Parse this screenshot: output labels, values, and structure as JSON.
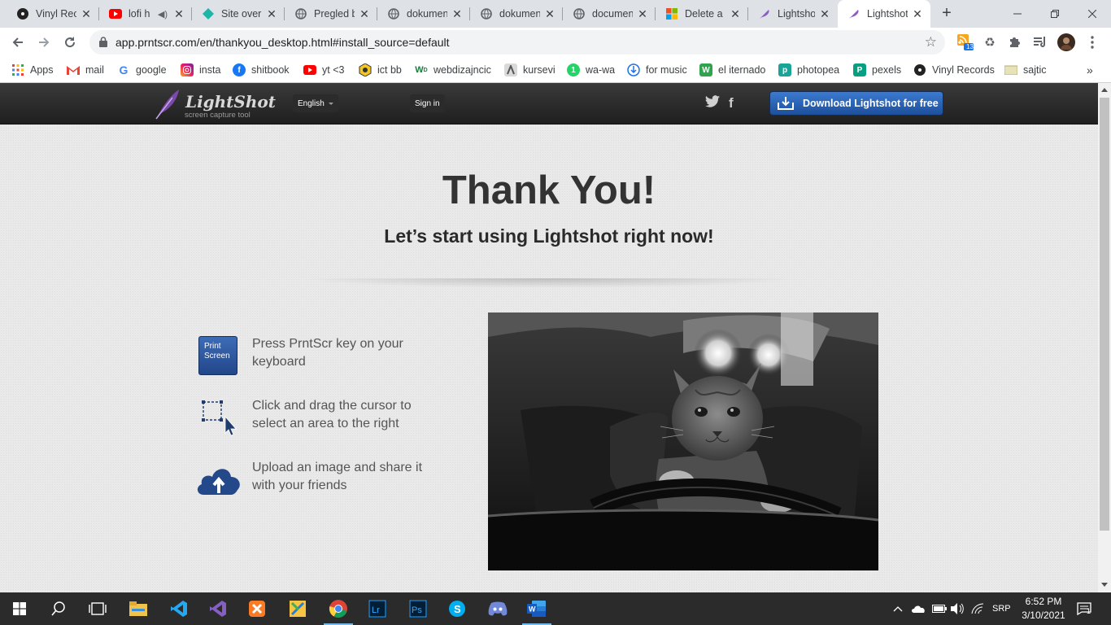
{
  "browser": {
    "tabs": [
      {
        "title": "Vinyl Rec",
        "icon": "vinyl-icon"
      },
      {
        "title": "lofi h",
        "icon": "youtube-icon",
        "audio": true
      },
      {
        "title": "Site over",
        "icon": "diamond-icon"
      },
      {
        "title": "Pregled b",
        "icon": "globe-icon"
      },
      {
        "title": "dokumen",
        "icon": "globe-icon"
      },
      {
        "title": "dokumen",
        "icon": "globe-icon"
      },
      {
        "title": "documen",
        "icon": "globe-icon"
      },
      {
        "title": "Delete a",
        "icon": "microsoft-icon"
      },
      {
        "title": "Lightshot",
        "icon": "feather-icon"
      },
      {
        "title": "Lightshot",
        "icon": "feather-icon",
        "active": true
      }
    ],
    "address": "app.prntscr.com/en/thankyou_desktop.html#install_source=default",
    "extension_badge": "13",
    "bookmarks": [
      {
        "label": "Apps",
        "icon": "apps-grid-icon"
      },
      {
        "label": "mail",
        "icon": "gmail-icon"
      },
      {
        "label": "google",
        "icon": "google-icon"
      },
      {
        "label": "insta",
        "icon": "instagram-icon"
      },
      {
        "label": "shitbook",
        "icon": "facebook-icon"
      },
      {
        "label": "yt <3",
        "icon": "youtube-icon"
      },
      {
        "label": "ict bb",
        "icon": "badge-icon"
      },
      {
        "label": "webdizajncic",
        "icon": "wd-icon"
      },
      {
        "label": "kursevi",
        "icon": "kursevi-icon"
      },
      {
        "label": "wa-wa",
        "icon": "whatsapp-icon"
      },
      {
        "label": "for music",
        "icon": "download-icon"
      },
      {
        "label": "el iternado",
        "icon": "w-icon"
      },
      {
        "label": "photopea",
        "icon": "photopea-icon"
      },
      {
        "label": "pexels",
        "icon": "pexels-icon"
      },
      {
        "label": "Vinyl Records",
        "icon": "vinyl-icon"
      },
      {
        "label": "sajtic",
        "icon": "folder-icon"
      }
    ]
  },
  "site": {
    "logo_name": "LightShot",
    "logo_tagline": "screen capture tool",
    "language": "English",
    "signin": "Sign in",
    "download_button": "Download Lightshot for free",
    "heading": "Thank You!",
    "subheading": "Let’s start using Lightshot right now!",
    "steps": [
      {
        "icon": "print-screen-key-icon",
        "key_label": "Print Screen",
        "text": "Press PrntScr key on your keyboard"
      },
      {
        "icon": "select-area-cursor-icon",
        "text": "Click and drag the cursor to select an area to the right"
      },
      {
        "icon": "cloud-upload-icon",
        "text": "Upload an image and share it with your friends"
      }
    ],
    "image_subject": "cat-at-steering-wheel-photo"
  },
  "taskbar": {
    "apps": [
      "start-icon",
      "search-icon",
      "task-view-icon",
      "file-explorer-icon",
      "vscode-icon",
      "visual-studio-icon",
      "xampp-icon",
      "app-icon",
      "chrome-icon",
      "lightroom-icon",
      "photoshop-icon",
      "skype-icon",
      "discord-icon",
      "word-icon"
    ],
    "language": "SRP",
    "time": "6:52 PM",
    "date": "3/10/2021",
    "notifications": "1"
  },
  "colors": {
    "accent_blue": "#2a5ca8",
    "header_dark": "#262626",
    "page_bg": "#e9e9e9"
  }
}
